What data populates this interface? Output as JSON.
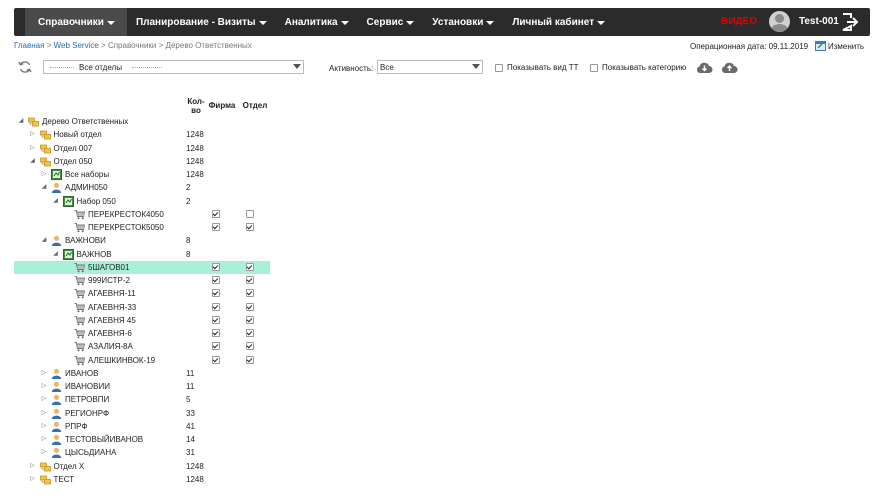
{
  "nav": {
    "items": [
      {
        "label": "Справочники",
        "active": true
      },
      {
        "label": "Планирование - Визиты"
      },
      {
        "label": "Аналитика"
      },
      {
        "label": "Сервис"
      },
      {
        "label": "Установки"
      },
      {
        "label": "Личный кабинет"
      }
    ],
    "video": "ВИДЕО",
    "user": "Test-001"
  },
  "breadcrumb": [
    "Главная",
    "Web Service",
    "Справочники",
    "Дерево Ответственных"
  ],
  "breadcrumb_sep": ">",
  "opdate": "Операционная дата: 09.11.2019",
  "change_label": "Изменить",
  "toolbar": {
    "dept_value": "Все отделы",
    "activity_label": "Активность:",
    "activity_value": "Все",
    "show_tt": "Показывать вид ТТ",
    "show_categories": "Показывать категорию"
  },
  "table": {
    "col_count": "Кол-во",
    "col_firm": "Фирма",
    "col_dept": "Отдел"
  },
  "colors": {
    "selected_row": "#a8f0d8",
    "video": "#e00000",
    "nav_bg": "#2b2b2b"
  },
  "tree": [
    {
      "label": "Дерево Ответственных",
      "level": 0,
      "icon": "folder-tree-icon",
      "toggle": "open"
    },
    {
      "label": "Новый отдел",
      "level": 1,
      "icon": "folder-tree-icon",
      "toggle": "closed",
      "count": "1248"
    },
    {
      "label": "Отдел 007",
      "level": 1,
      "icon": "folder-tree-icon",
      "toggle": "closed",
      "count": "1248"
    },
    {
      "label": "Отдел 050",
      "level": 1,
      "icon": "folder-tree-icon",
      "toggle": "open",
      "count": "1248"
    },
    {
      "label": "Все наборы",
      "level": 2,
      "icon": "set-icon",
      "toggle": "closed",
      "count": "1248"
    },
    {
      "label": "АДМИН050",
      "level": 2,
      "icon": "user-icon",
      "toggle": "open",
      "count": "2"
    },
    {
      "label": "Набор 050",
      "level": 3,
      "icon": "set-icon",
      "toggle": "open",
      "count": "2"
    },
    {
      "label": "ПЕРЕКРЕСТОК4050",
      "level": 4,
      "icon": "cart-icon",
      "firm": true,
      "dept": false
    },
    {
      "label": "ПЕРЕКРЕСТОК5050",
      "level": 4,
      "icon": "cart-icon",
      "firm": true,
      "dept": true
    },
    {
      "label": "ВАЖНОВИ",
      "level": 2,
      "icon": "user-icon",
      "toggle": "open",
      "count": "8"
    },
    {
      "label": "ВАЖНОВ",
      "level": 3,
      "icon": "set-icon",
      "toggle": "open",
      "count": "8"
    },
    {
      "label": "5ШАГОВ01",
      "level": 4,
      "icon": "cart-icon",
      "firm": true,
      "dept": true,
      "selected": true
    },
    {
      "label": "999ИСТР-2",
      "level": 4,
      "icon": "cart-icon",
      "firm": true,
      "dept": true
    },
    {
      "label": "АГАЕВНЯ-11",
      "level": 4,
      "icon": "cart-icon",
      "firm": true,
      "dept": true
    },
    {
      "label": "АГАЕВНЯ-33",
      "level": 4,
      "icon": "cart-icon",
      "firm": true,
      "dept": true
    },
    {
      "label": "АГАЕВНЯ 45",
      "level": 4,
      "icon": "cart-icon",
      "firm": true,
      "dept": true
    },
    {
      "label": "АГАЕВНЯ-6",
      "level": 4,
      "icon": "cart-icon",
      "firm": true,
      "dept": true
    },
    {
      "label": "АЗАЛИЯ-8А",
      "level": 4,
      "icon": "cart-icon",
      "firm": true,
      "dept": true
    },
    {
      "label": "АЛЕШКИНВОК-19",
      "level": 4,
      "icon": "cart-icon",
      "firm": true,
      "dept": true
    },
    {
      "label": "ИВАНОВ",
      "level": 2,
      "icon": "user-icon",
      "toggle": "closed",
      "count": "11"
    },
    {
      "label": "ИВАНОВИИ",
      "level": 2,
      "icon": "user-icon",
      "toggle": "closed",
      "count": "11"
    },
    {
      "label": "ПЕТРОВПИ",
      "level": 2,
      "icon": "user-icon",
      "toggle": "closed",
      "count": "5"
    },
    {
      "label": "РЕГИОНРФ",
      "level": 2,
      "icon": "user-icon",
      "toggle": "closed",
      "count": "33"
    },
    {
      "label": "РПРФ",
      "level": 2,
      "icon": "user-icon",
      "toggle": "closed",
      "count": "41"
    },
    {
      "label": "ТЕСТОВЫЙИВАНОВ",
      "level": 2,
      "icon": "user-icon",
      "toggle": "closed",
      "count": "14"
    },
    {
      "label": "ЦЫСЬДИАНА",
      "level": 2,
      "icon": "user-icon",
      "toggle": "closed",
      "count": "31"
    },
    {
      "label": "Отдел X",
      "level": 1,
      "icon": "folder-tree-icon",
      "toggle": "closed",
      "count": "1248"
    },
    {
      "label": "ТЕСТ",
      "level": 1,
      "icon": "folder-tree-icon",
      "toggle": "closed",
      "count": "1248"
    }
  ]
}
